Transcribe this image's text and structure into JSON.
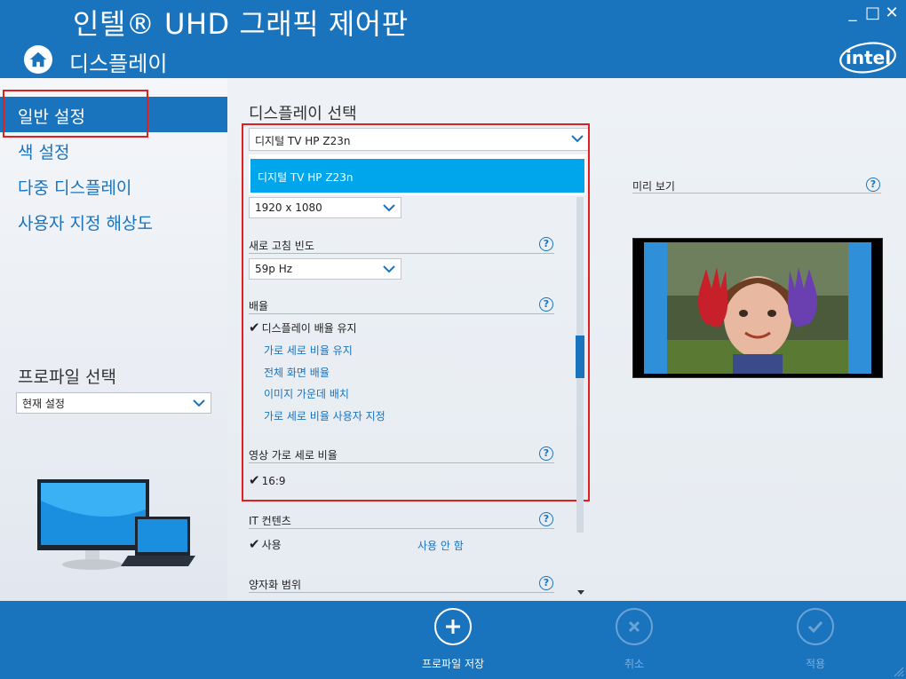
{
  "window": {
    "title": "인텔® UHD 그래픽 제어판",
    "minimize": "_",
    "maximize": "□",
    "close": "✕"
  },
  "header": {
    "section_title": "디스플레이",
    "home_icon": "home-icon",
    "brand": "intel"
  },
  "sidebar": {
    "items": [
      {
        "label": "일반 설정",
        "selected": true
      },
      {
        "label": "색 설정"
      },
      {
        "label": "다중 디스플레이"
      },
      {
        "label": "사용자 지정 해상도"
      }
    ],
    "profile_label": "프로파일 선택",
    "profile_value": "현재 설정"
  },
  "main": {
    "display_select_heading": "디스플레이 선택",
    "display_selected": "디지털 TV HP Z23n",
    "dropdown_options": [
      "디지털 TV HP Z23n"
    ],
    "resolution": "1920 x 1080",
    "refresh_label": "새로 고침 빈도",
    "refresh_value": "59p Hz",
    "scaling_label": "배율",
    "scaling_selected": "디스플레이 배율 유지",
    "scaling_options": [
      "가로 세로 비율 유지",
      "전체 화면 배율",
      "이미지 가운데 배치",
      "가로 세로 비율 사용자 지정"
    ],
    "aspect_label": "영상 가로 세로 비율",
    "aspect_selected": "16:9",
    "it_content_label": "IT 컨텐츠",
    "it_content_on": "사용",
    "it_content_off": "사용 안 함",
    "quantization_label": "양자화 범위",
    "help_glyph": "?",
    "check_glyph": "✔"
  },
  "preview": {
    "label": "미리 보기"
  },
  "footer": {
    "save_label": "프로파일 저장",
    "cancel_label": "취소",
    "apply_label": "적용"
  },
  "colors": {
    "accent": "#1a73bd",
    "dropdown_highlight": "#00a6ec",
    "annotation_red": "#e02020"
  }
}
